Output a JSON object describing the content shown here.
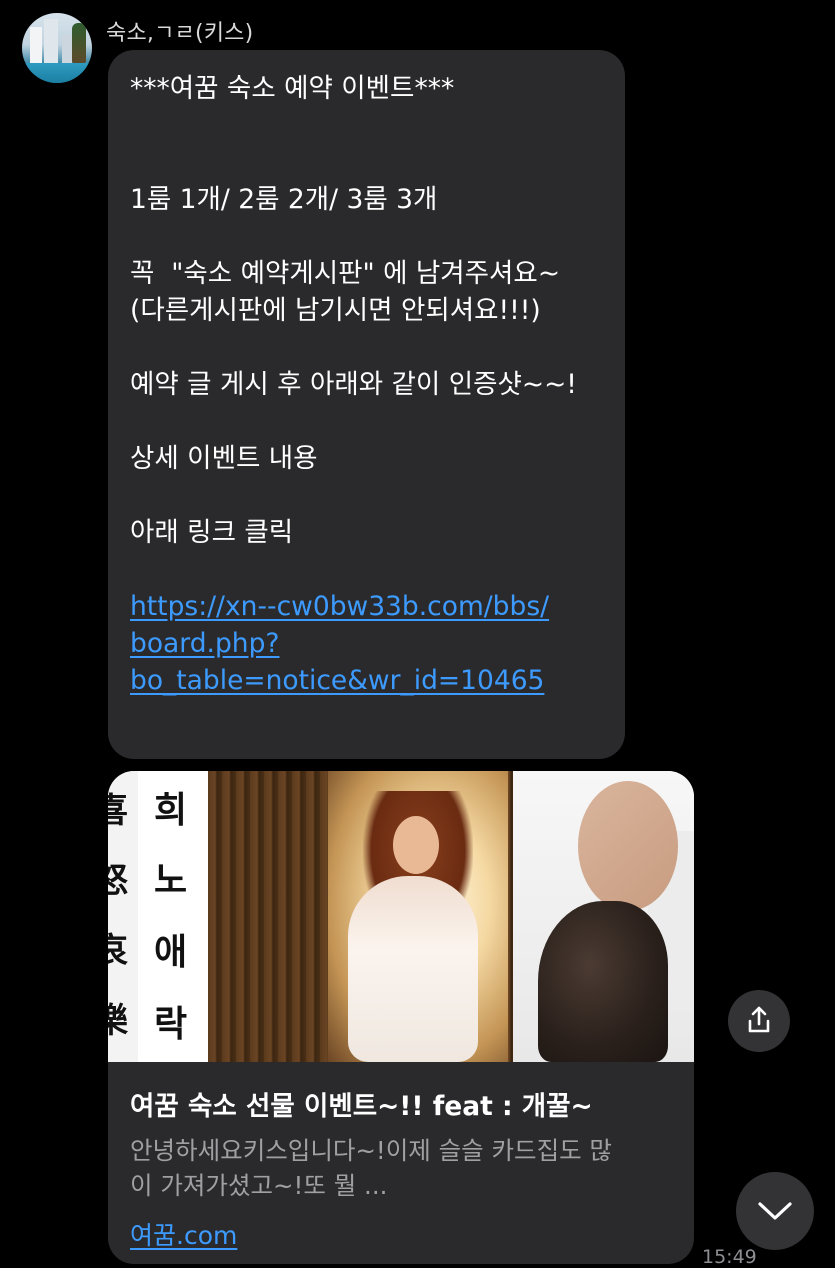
{
  "sender": {
    "name": "숙소,ㄱㄹ(키스)"
  },
  "message": {
    "lines": [
      "***여꿈 숙소 예약 이벤트***",
      "",
      "",
      "1룸 1개/ 2룸 2개/ 3룸 3개",
      "",
      "꼭  \"숙소 예약게시판\" 에 남겨주셔요~",
      "(다른게시판에 남기시면 안되셔요!!!)",
      "",
      "예약 글 게시 후 아래와 같이 인증샷~~!",
      "",
      "상세 이벤트 내용",
      "",
      "아래 링크 클릭",
      ""
    ],
    "link_lines": [
      "https://xn--cw0bw33b.com/bbs/",
      "board.php?",
      "bo_table=notice&wr_id=10465"
    ]
  },
  "link_preview": {
    "image_hanja": [
      "喜",
      "怒",
      "哀",
      "樂"
    ],
    "image_hangul": [
      "희",
      "노",
      "애",
      "락"
    ],
    "title": "여꿈 숙소 선물 이벤트~!! feat : 개꿀~",
    "description_lines": [
      "안녕하세요키스입니다~!이제 슬슬 카드집도 많",
      "이 가져가셨고~!또 뭘 ..."
    ],
    "domain": "여꿈.com"
  },
  "timestamp": "15:49",
  "icons": {
    "share": "share-icon",
    "scroll_down": "chevron-down-icon"
  },
  "colors": {
    "background": "#000000",
    "bubble": "#2a2a2c",
    "link": "#3d9bff",
    "secondary_text": "#a0a0a4"
  }
}
